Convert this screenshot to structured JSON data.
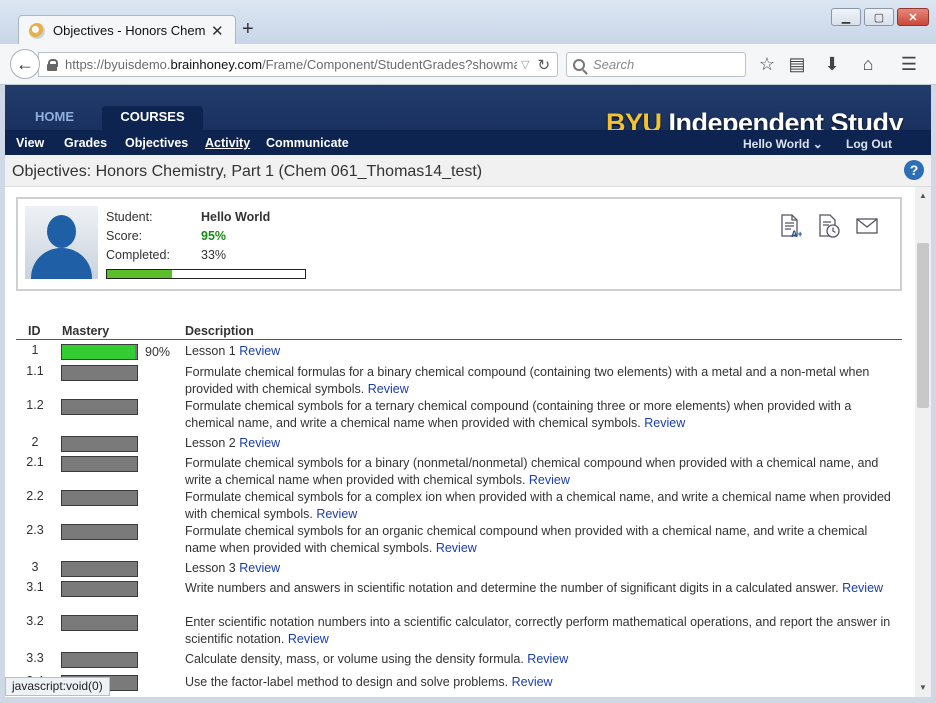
{
  "browser": {
    "tab_title": "Objectives - Honors Chemi...",
    "url_prefix": "https://byuisdemo.",
    "url_domain": "brainhoney.com",
    "url_path": "/Frame/Component/StudentGrades?showmastery",
    "search_placeholder": "Search",
    "status_text": "javascript:void(0)"
  },
  "header": {
    "nav_home": "HOME",
    "nav_courses": "COURSES",
    "brand_byu": "BYU",
    "brand_rest": " Independent Study"
  },
  "subnav": {
    "items": [
      "View",
      "Grades",
      "Objectives",
      "Activity",
      "Communicate"
    ],
    "user": "Hello World",
    "logout": "Log Out"
  },
  "page": {
    "title": "Objectives: Honors Chemistry, Part 1 (Chem 061_Thomas14_test)"
  },
  "student": {
    "student_label": "Student:",
    "student_name": "Hello World",
    "score_label": "Score:",
    "score_value": "95%",
    "completed_label": "Completed:",
    "completed_value": "33%",
    "completed_fraction": 0.33
  },
  "table": {
    "headers": {
      "id": "ID",
      "mastery": "Mastery",
      "description": "Description"
    },
    "review_label": "Review",
    "rows": [
      {
        "id": "1",
        "mastery": 0.97,
        "pct": "90%",
        "desc": "Lesson 1"
      },
      {
        "id": "1.1",
        "mastery": 0,
        "desc": "Formulate chemical formulas for a binary chemical compound (containing two elements) with a metal and a non-metal when provided with chemical symbols."
      },
      {
        "id": "1.2",
        "mastery": 0,
        "desc": "Formulate chemical symbols for a ternary chemical compound (containing three or more elements) when provided with a chemical name, and write a chemical name when provided with chemical symbols."
      },
      {
        "id": "2",
        "mastery": 0,
        "desc": "Lesson 2"
      },
      {
        "id": "2.1",
        "mastery": 0,
        "desc": "Formulate chemical symbols for a binary (nonmetal/nonmetal) chemical compound when provided with a chemical name, and write a chemical name when provided with chemical symbols."
      },
      {
        "id": "2.2",
        "mastery": 0,
        "desc": "Formulate chemical symbols for a complex ion when provided with a chemical name, and write a chemical name when provided with chemical symbols."
      },
      {
        "id": "2.3",
        "mastery": 0,
        "desc": "Formulate chemical symbols for an organic chemical compound when provided with a chemical name, and write a chemical name when provided with chemical symbols."
      },
      {
        "id": "3",
        "mastery": 0,
        "desc": "Lesson 3"
      },
      {
        "id": "3.1",
        "mastery": 0,
        "desc": "Write numbers and answers in scientific notation and determine the number of significant digits in a calculated answer."
      },
      {
        "id": "3.2",
        "mastery": 0,
        "desc": "Enter scientific notation numbers into a scientific calculator, correctly perform mathematical operations, and report the answer in scientific notation."
      },
      {
        "id": "3.3",
        "mastery": 0,
        "desc": "Calculate density, mass, or volume using the density formula."
      },
      {
        "id": "3.4",
        "mastery": 0,
        "desc": "Use the factor-label method to design and solve problems."
      }
    ]
  }
}
